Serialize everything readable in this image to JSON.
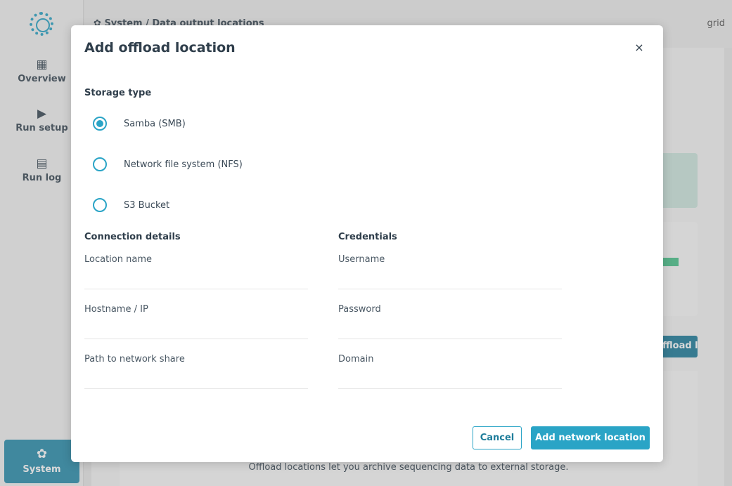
{
  "sidebar": {
    "items": [
      {
        "label": "Overview",
        "icon": "grid-icon"
      },
      {
        "label": "Run setup",
        "icon": "play-icon"
      },
      {
        "label": "Run log",
        "icon": "document-icon"
      },
      {
        "label": "System",
        "icon": "gear-icon"
      }
    ]
  },
  "header": {
    "breadcrumb": "System / Data output locations",
    "user": "grid"
  },
  "background": {
    "action_button_label": "Add offload location",
    "footer_note": "Offload locations let you archive sequencing data to external storage."
  },
  "modal": {
    "title": "Add offload location",
    "close_symbol": "×",
    "storage_type_label": "Storage type",
    "storage_options": [
      {
        "label": "Samba (SMB)",
        "selected": true
      },
      {
        "label": "Network file system (NFS)",
        "selected": false
      },
      {
        "label": "S3 Bucket",
        "selected": false
      }
    ],
    "connection_label": "Connection details",
    "credentials_label": "Credentials",
    "fields": {
      "location_name": {
        "label": "Location name",
        "value": ""
      },
      "hostname": {
        "label": "Hostname / IP",
        "value": ""
      },
      "path": {
        "label": "Path to network share",
        "value": ""
      },
      "username": {
        "label": "Username",
        "value": ""
      },
      "password": {
        "label": "Password",
        "value": ""
      },
      "domain": {
        "label": "Domain",
        "value": ""
      }
    },
    "cancel_label": "Cancel",
    "submit_label": "Add network location"
  },
  "colors": {
    "accent": "#2aa4c6",
    "sidebar_active": "#2b8fae",
    "text_dark": "#2f3e4b"
  }
}
